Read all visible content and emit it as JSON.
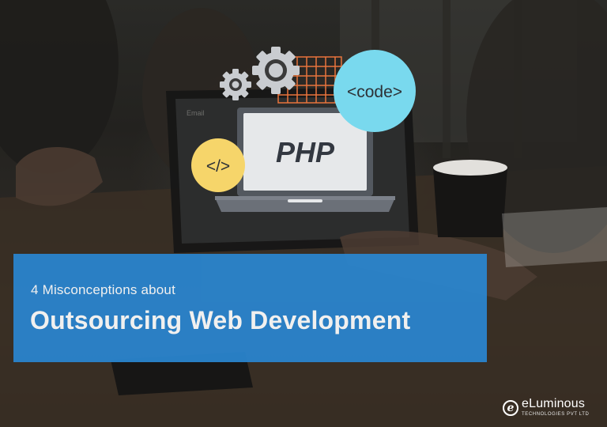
{
  "illustration": {
    "code_bubble": "<code>",
    "tag_bubble": "</>",
    "screen_text": "PHP",
    "email_label": "Email",
    "colors": {
      "bubble_cyan": "#79d9ee",
      "bubble_yellow": "#f6d56a",
      "grid_orange": "#e8743d",
      "gear_grey": "#c9ccd0",
      "screen": "#e6e8ea",
      "laptop": "#53585f"
    },
    "icons": [
      "gear-icon",
      "code-bubble-icon",
      "html-tag-icon",
      "laptop-icon"
    ]
  },
  "banner": {
    "subtitle": "4 Misconceptions about",
    "title": "Outsourcing Web Development",
    "color": "#2a86d1"
  },
  "brand": {
    "mark": "e",
    "name": "eLuminous",
    "tagline": "TECHNOLOGIES PVT LTD"
  }
}
